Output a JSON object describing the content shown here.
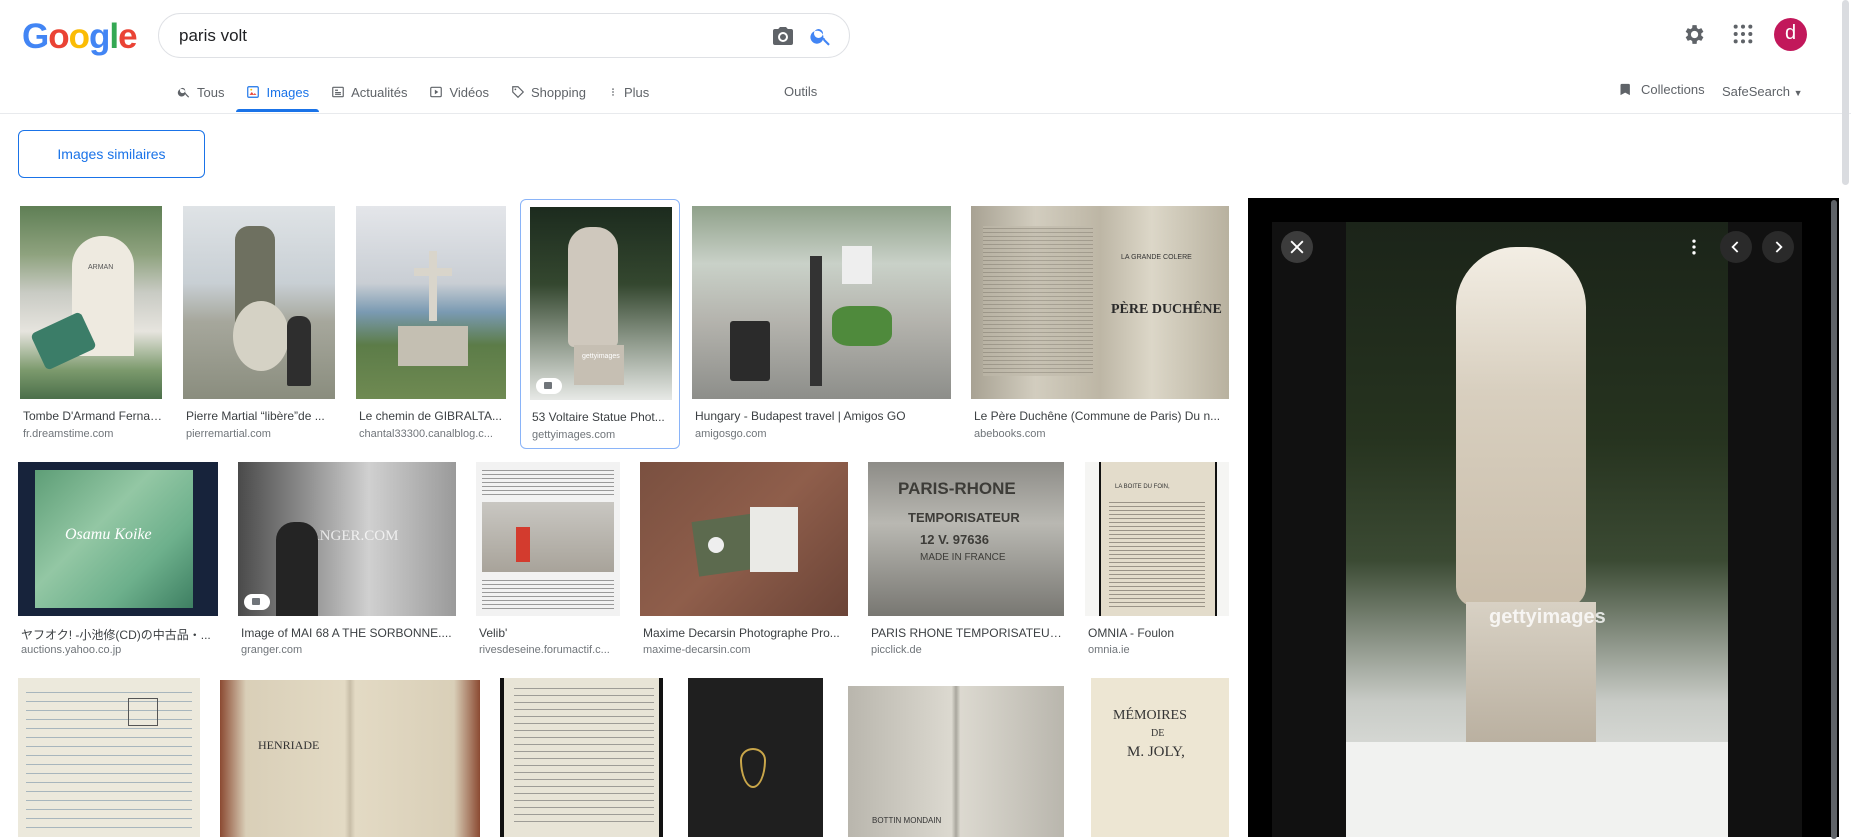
{
  "search": {
    "query": "paris volt"
  },
  "logo": [
    "G",
    "o",
    "o",
    "g",
    "l",
    "e"
  ],
  "user": {
    "avatar_letter": "d"
  },
  "tabs": [
    {
      "label": "Tous",
      "icon": "search-icon"
    },
    {
      "label": "Images",
      "icon": "image-icon"
    },
    {
      "label": "Actualités",
      "icon": "news-icon"
    },
    {
      "label": "Vidéos",
      "icon": "video-icon"
    },
    {
      "label": "Shopping",
      "icon": "tag-icon"
    },
    {
      "label": "Plus",
      "icon": "more-vert-icon"
    }
  ],
  "toolbar": {
    "outils": "Outils",
    "collections": "Collections",
    "safesearch": "SafeSearch"
  },
  "similar_button": "Images similaires",
  "results": [
    {
      "title": "Tombe D'Armand Fernan...",
      "source": "fr.dreamstime.com"
    },
    {
      "title": "Pierre Martial “libère”de ...",
      "source": "pierremartial.com"
    },
    {
      "title": "Le chemin de GIBRALTA...",
      "source": "chantal33300.canalblog.c..."
    },
    {
      "title": "53 Voltaire Statue Phot...",
      "source": "gettyimages.com"
    },
    {
      "title": "Hungary - Budapest travel | Amigos GO",
      "source": "amigosgo.com"
    },
    {
      "title": "Le Père Duchêne (Commune de Paris) Du n...",
      "source": "abebooks.com"
    },
    {
      "title": "ヤフオク! -小池修(CD)の中古品・...",
      "source": "auctions.yahoo.co.jp"
    },
    {
      "title": "Image of MAI 68 A THE SORBONNE....",
      "source": "granger.com"
    },
    {
      "title": "Velib'",
      "source": "rivesdeseine.forumactif.c..."
    },
    {
      "title": "Maxime Decarsin Photographe Pro...",
      "source": "maxime-decarsin.com"
    },
    {
      "title": "PARIS RHONE TEMPORISATEUR...",
      "source": "picclick.de"
    },
    {
      "title": "OMNIA - Foulon",
      "source": "omnia.ie"
    }
  ],
  "thumb_text": {
    "dreamstime": "ARMAN",
    "granger": "GRANGER.COM",
    "paris_rhone_1": "PARIS-RHONE",
    "paris_rhone_2": "TEMPORISATEUR",
    "paris_rhone_3": "12 V.  97636",
    "paris_rhone_4": "MADE IN FRANCE",
    "duchene_1": "LA GRANDE COLERE",
    "duchene_2": "PÈRE DUCHÊNE",
    "omnia_1": "LA BOITE DU FOIN,",
    "cd": "Osamu Koike",
    "memoires_1": "MÉMOIRES",
    "memoires_2": "DE",
    "memoires_3": "M. JOLY,",
    "henriade": "HENRIADE",
    "bottin": "BOTTIN MONDAIN",
    "getty": "gettyimages"
  }
}
